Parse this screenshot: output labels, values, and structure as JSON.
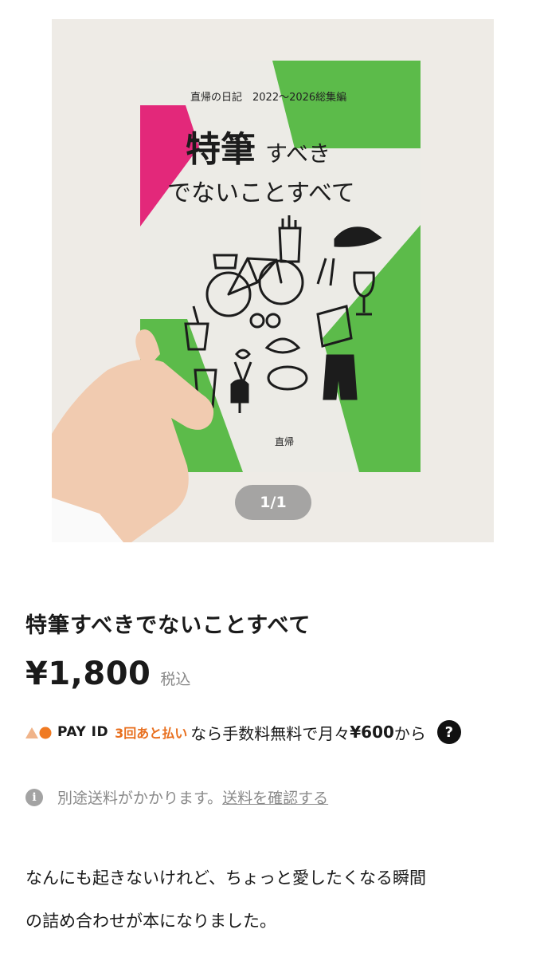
{
  "gallery": {
    "counter": "1/1",
    "cover": {
      "series": "直帰の日記　2022〜2026総集編",
      "title_big": "特筆",
      "title_small": "すべき",
      "title_line2": "でないことすべて",
      "author": "直帰",
      "colors": {
        "green": "#5cbb4a",
        "magenta": "#e3287a",
        "paper": "#ecebe6",
        "ink": "#1c1c1c"
      }
    }
  },
  "product": {
    "title": "特筆すべきでないことすべて",
    "price": "¥1,800",
    "tax_label": "税込"
  },
  "payid": {
    "brand": "PAY ID",
    "later": "3回あと払い",
    "text_before": "なら手数料無料で月々",
    "amount": "¥600",
    "text_after": "から",
    "help": "?"
  },
  "shipping": {
    "info": "i",
    "text": "別途送料がかかります。",
    "link": "送料を確認する"
  },
  "description": {
    "lines": [
      "なんにも起きないけれど、ちょっと愛したくなる瞬間",
      "の詰め合わせが本になりました。"
    ]
  }
}
